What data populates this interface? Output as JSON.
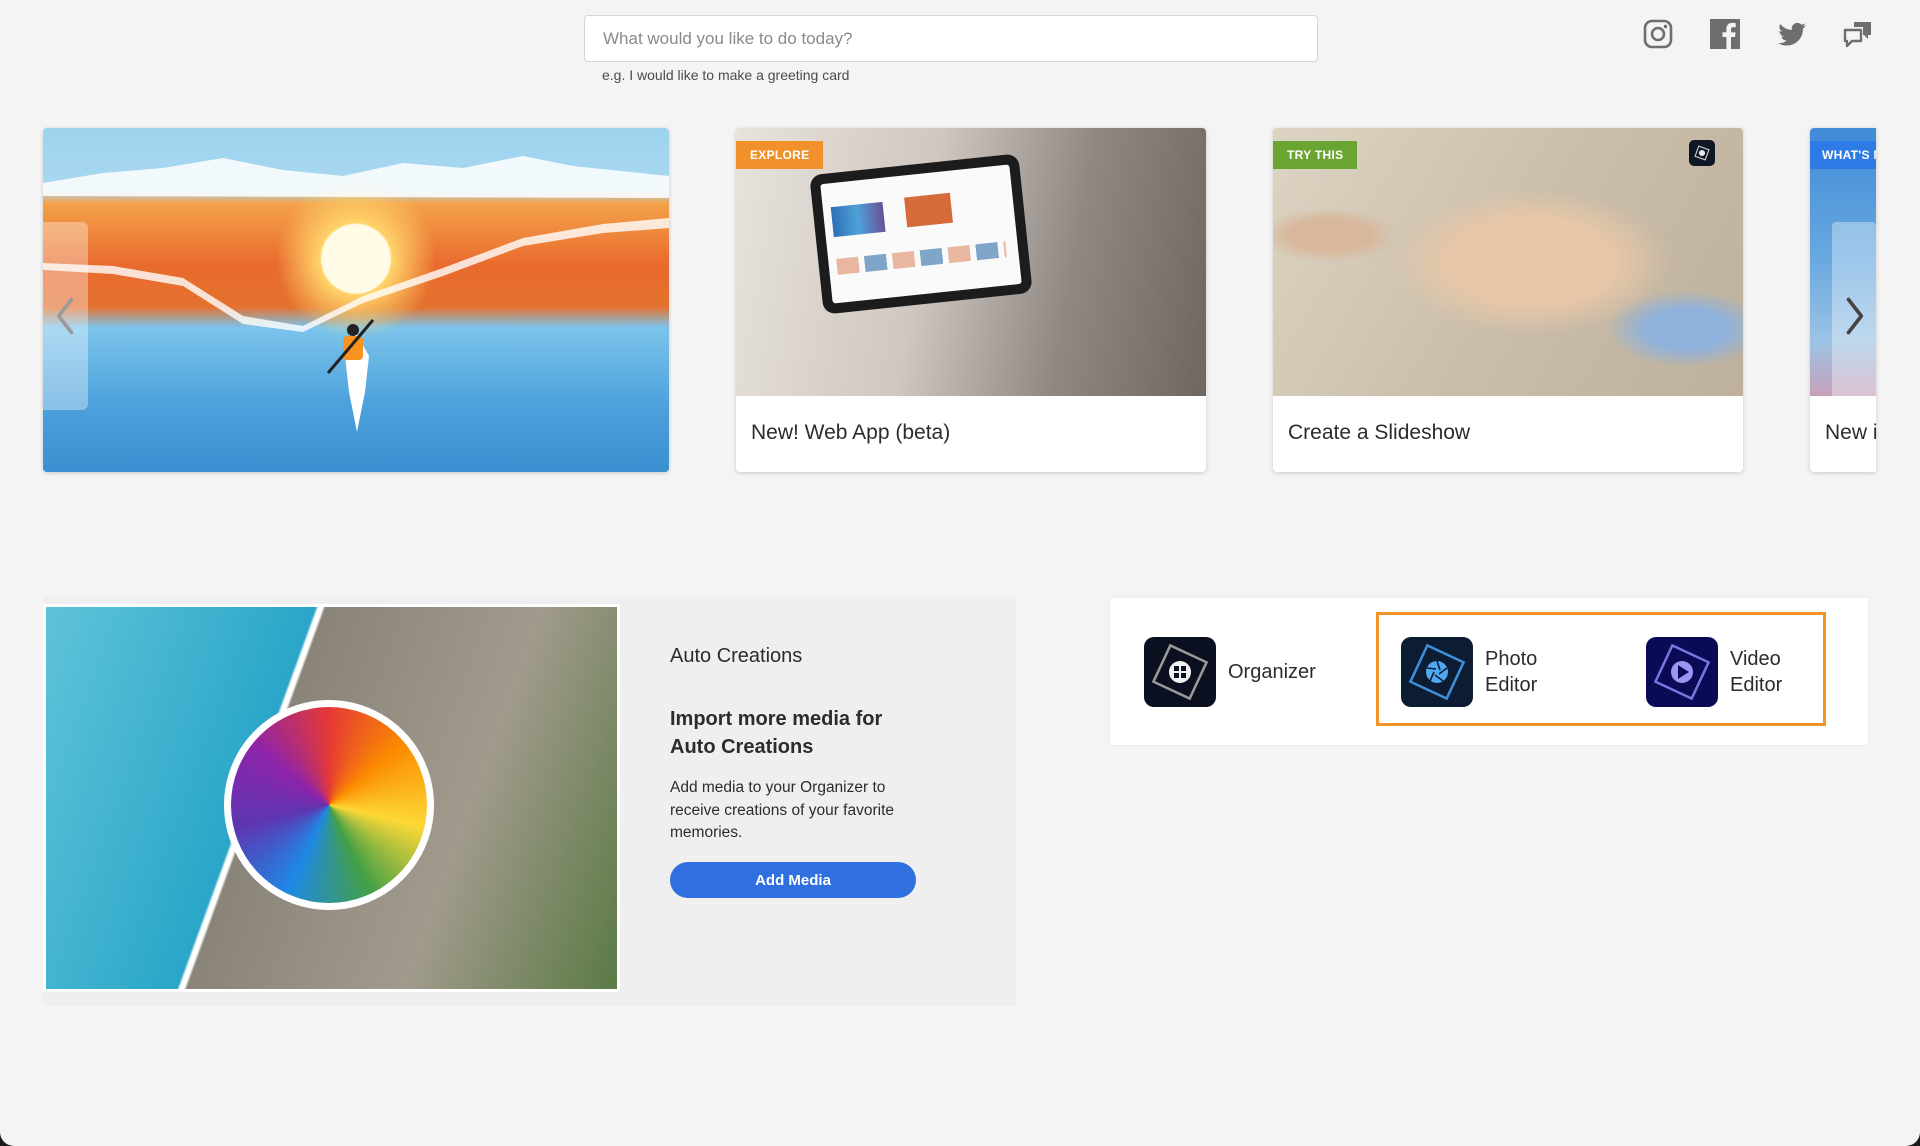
{
  "search": {
    "placeholder": "What would you like to do today?",
    "hint": "e.g. I would like to make a greeting card"
  },
  "social": [
    {
      "name": "instagram-icon",
      "label": "Instagram"
    },
    {
      "name": "facebook-icon",
      "label": "Facebook"
    },
    {
      "name": "twitter-icon",
      "label": "Twitter"
    },
    {
      "name": "chat-feedback-icon",
      "label": "Community"
    }
  ],
  "carousel": {
    "prev_icon": "chevron-left-icon",
    "next_icon": "chevron-right-icon",
    "cards": [
      {
        "badge": "",
        "caption": "",
        "image": "kayak-sunset-torn-paper"
      },
      {
        "badge": "EXPLORE",
        "badge_color": "#f0912c",
        "caption": "New! Web App (beta)",
        "image": "woman-holding-tablet"
      },
      {
        "badge": "TRY THIS",
        "badge_color": "#6aa531",
        "caption": "Create a Slideshow",
        "image": "children-slideshow-collage",
        "app_icon": "organizer-icon"
      },
      {
        "badge": "WHAT'S N",
        "badge_color": "#2f7be6",
        "caption": "New i",
        "image": "flowers-blue-sky"
      }
    ]
  },
  "auto_creations": {
    "title": "Auto Creations",
    "heading": "Import more media for Auto Creations",
    "description": "Add media to your Organizer to receive creations of your favorite memories.",
    "button": "Add Media",
    "button_color": "#2f6fe0"
  },
  "apps": {
    "highlight_color": "#f29427",
    "items": [
      {
        "label": "Organizer",
        "icon": "organizer-icon"
      },
      {
        "label_line1": "Photo",
        "label_line2": "Editor",
        "icon": "photo-editor-icon"
      },
      {
        "label_line1": "Video",
        "label_line2": "Editor",
        "icon": "video-editor-icon"
      }
    ]
  }
}
